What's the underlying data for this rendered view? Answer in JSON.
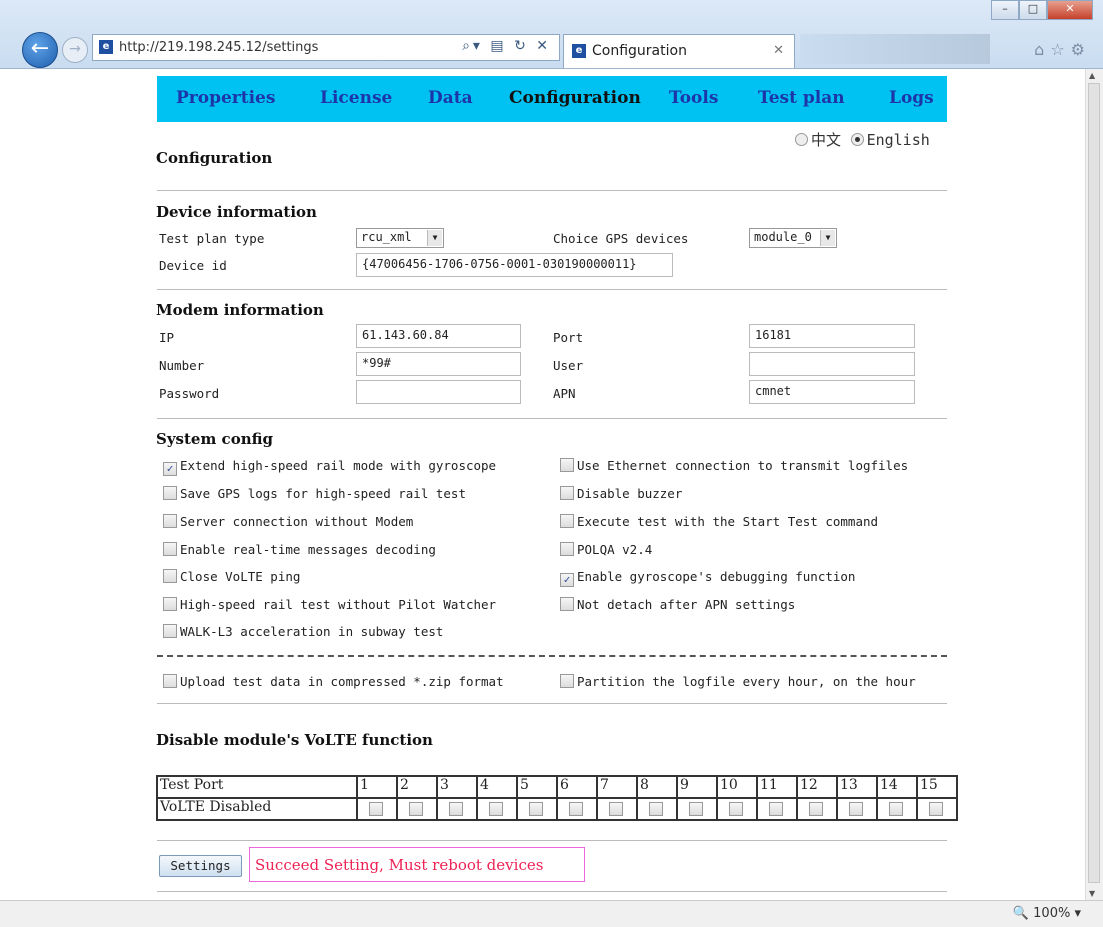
{
  "browser": {
    "url": "http://219.198.245.12/settings",
    "tab_title": "Configuration",
    "zoom": "100%"
  },
  "nav": [
    "Properties",
    "License",
    "Data",
    "Configuration",
    "Tools",
    "Test plan",
    "Logs"
  ],
  "language": {
    "chinese": "中文",
    "english": "English",
    "selected": "English"
  },
  "page_title": "Configuration",
  "device_information": {
    "heading": "Device information",
    "test_plan_type_label": "Test plan type",
    "test_plan_type_value": "rcu_xml",
    "gps_label": "Choice GPS devices",
    "gps_value": "module_0",
    "device_id_label": "Device id",
    "device_id_value": "{47006456-1706-0756-0001-030190000011}"
  },
  "modem_information": {
    "heading": "Modem information",
    "ip_label": "IP",
    "ip_value": "61.143.60.84",
    "port_label": "Port",
    "port_value": "16181",
    "number_label": "Number",
    "number_value": "*99#",
    "user_label": "User",
    "user_value": "",
    "password_label": "Password",
    "password_value": "",
    "apn_label": "APN",
    "apn_value": "cmnet"
  },
  "system_config": {
    "heading": "System config",
    "left": [
      {
        "label": "Extend high-speed rail mode with gyroscope",
        "checked": true
      },
      {
        "label": "Save GPS logs for high-speed rail test",
        "checked": false
      },
      {
        "label": "Server connection without Modem",
        "checked": false
      },
      {
        "label": "Enable real-time messages decoding",
        "checked": false
      },
      {
        "label": "Close VoLTE ping",
        "checked": false
      },
      {
        "label": "High-speed rail test without Pilot Watcher",
        "checked": false
      },
      {
        "label": "WALK-L3 acceleration in subway test",
        "checked": false
      }
    ],
    "right": [
      {
        "label": "Use Ethernet connection to transmit logfiles",
        "checked": false
      },
      {
        "label": "Disable buzzer",
        "checked": false
      },
      {
        "label": "Execute test with the Start Test command",
        "checked": false
      },
      {
        "label": "POLQA v2.4",
        "checked": false
      },
      {
        "label": "Enable gyroscope's debugging function",
        "checked": true
      },
      {
        "label": "Not detach after APN settings",
        "checked": false
      }
    ],
    "extra_left": {
      "label": "Upload test data in compressed *.zip format",
      "checked": false
    },
    "extra_right": {
      "label": "Partition the logfile every hour, on the hour",
      "checked": false
    }
  },
  "volte": {
    "heading": "Disable module's VoLTE function",
    "row1_label": "Test Port",
    "row2_label": "VoLTE Disabled",
    "ports": [
      "1",
      "2",
      "3",
      "4",
      "5",
      "6",
      "7",
      "8",
      "9",
      "10",
      "11",
      "12",
      "13",
      "14",
      "15"
    ]
  },
  "settings_button": "Settings",
  "status_message": "Succeed Setting, Must reboot devices"
}
